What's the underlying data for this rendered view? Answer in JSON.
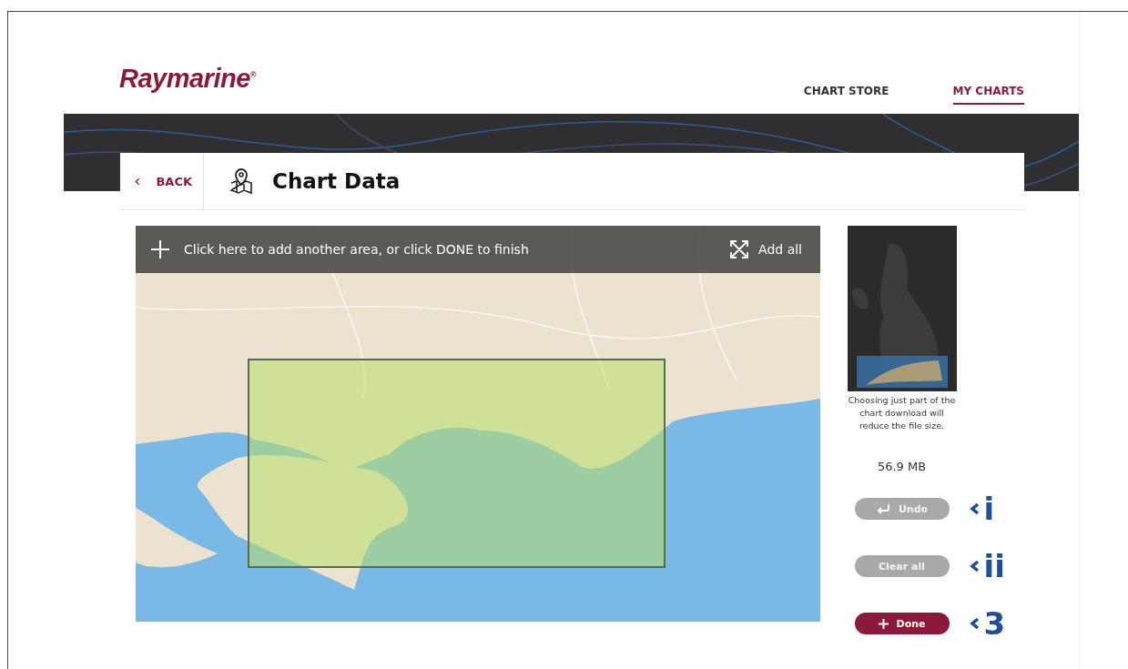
{
  "brand": {
    "logo": "Raymarine$^{®}$"
  },
  "nav": [
    {
      "label": "CHART STORE",
      "selected": false
    },
    {
      "label": "MY CHARTS",
      "selected": true
    }
  ],
  "page": {
    "back": "BACK",
    "title": "Chart Data"
  },
  "map": {
    "hint": "Click here to add another area, or click DONE to finish",
    "add_all": "Add all"
  },
  "sidebar": {
    "caption": "Choosing just part of the chart download will reduce the file size.",
    "file_size": "56.9 MB",
    "buttons": [
      {
        "label": "Undo",
        "kind": "undo",
        "disabled": true,
        "callout": "i"
      },
      {
        "label": "Clear all",
        "kind": "clear",
        "disabled": true,
        "callout": "ii"
      },
      {
        "label": "Done",
        "kind": "done",
        "disabled": false,
        "callout": "3"
      }
    ]
  }
}
